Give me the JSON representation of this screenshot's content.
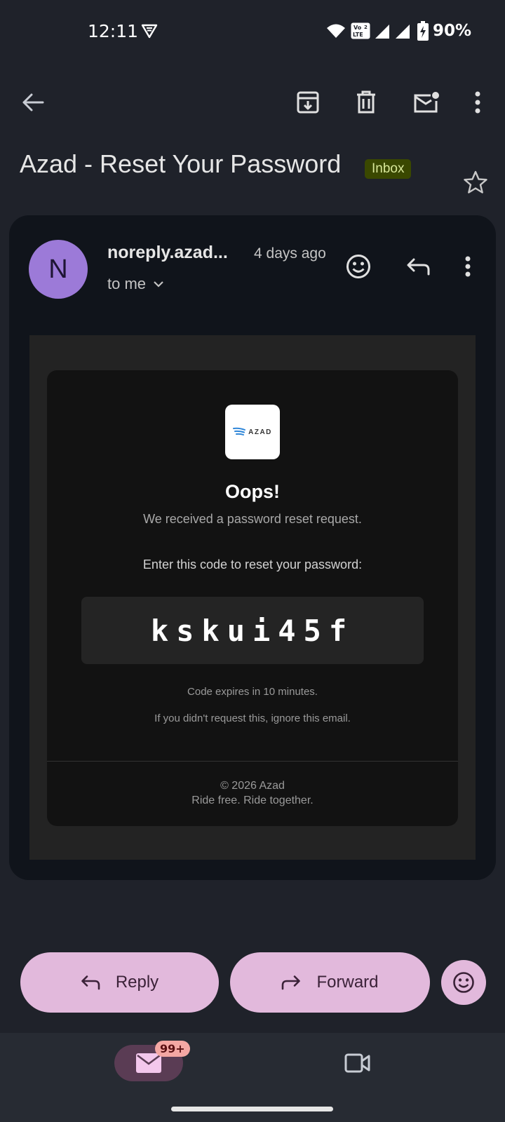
{
  "status_bar": {
    "time": "12:11",
    "battery": "90%",
    "volte_label_top": "Vo",
    "volte_label_bottom": "LTE",
    "sim_slot": "2"
  },
  "toolbar": {
    "icons": [
      "back-arrow-icon",
      "archive-icon",
      "delete-icon",
      "mark-unread-icon",
      "more-vert-icon"
    ]
  },
  "email": {
    "subject": "Azad - Reset Your Password",
    "label": "Inbox",
    "sender_initial": "N",
    "sender": "noreply.azad...",
    "time_ago": "4 days ago",
    "recipient": "to me"
  },
  "body": {
    "logo_text": "AZAD",
    "heading": "Oops!",
    "intro": "We received a password reset request.",
    "instruction": "Enter this code to reset your password:",
    "code": "kskui45f",
    "expiry": "Code expires in 10 minutes.",
    "ignore_note": "If you didn't request this, ignore this email.",
    "copyright": "© 2026 Azad",
    "tagline": "Ride free. Ride together."
  },
  "actions": {
    "reply_label": "Reply",
    "forward_label": "Forward"
  },
  "bottom_nav": {
    "mail_badge": "99+"
  },
  "colors": {
    "background": "#1f222a",
    "card": "#10141b",
    "accent_pill": "#e2b9dc",
    "avatar": "#9c7ad8",
    "inbox_label_bg": "#3a4800"
  }
}
